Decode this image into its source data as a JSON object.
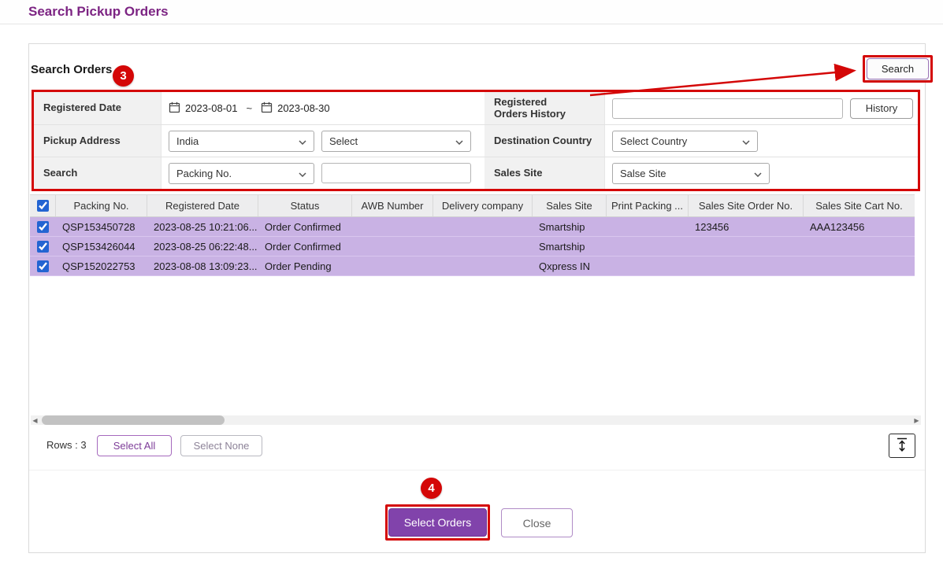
{
  "header": {
    "title": "Search Pickup Orders"
  },
  "search_panel": {
    "heading": "Search Orders",
    "step_badge_3": "3",
    "search_button": "Search",
    "rows": {
      "registered_date": {
        "label": "Registered Date",
        "from": "2023-08-01",
        "separator": "~",
        "to": "2023-08-30"
      },
      "registered_orders_history": {
        "label": "Registered Orders History",
        "input_value": "",
        "history_button": "History"
      },
      "pickup_address": {
        "label": "Pickup Address",
        "country_select": "India",
        "sub_select": "Select"
      },
      "destination_country": {
        "label": "Destination Country",
        "select": "Select Country"
      },
      "search": {
        "label": "Search",
        "type_select": "Packing No.",
        "input_value": ""
      },
      "sales_site": {
        "label": "Sales Site",
        "select": "Salse Site"
      }
    }
  },
  "orders_table": {
    "select_all_checked": true,
    "columns": [
      "Packing No.",
      "Registered Date",
      "Status",
      "AWB Number",
      "Delivery company",
      "Sales Site",
      "Print Packing ...",
      "Sales Site Order No.",
      "Sales Site Cart No."
    ],
    "rows": [
      {
        "selected": true,
        "packing_no": "QSP153450728",
        "registered_date": "2023-08-25 10:21:06...",
        "status": "Order Confirmed",
        "awb_number": "",
        "delivery_company": "",
        "sales_site": "Smartship",
        "print_packing": "",
        "sales_site_order_no": "123456",
        "sales_site_cart_no": "AAA123456"
      },
      {
        "selected": true,
        "packing_no": "QSP153426044",
        "registered_date": "2023-08-25 06:22:48...",
        "status": "Order Confirmed",
        "awb_number": "",
        "delivery_company": "",
        "sales_site": "Smartship",
        "print_packing": "",
        "sales_site_order_no": "",
        "sales_site_cart_no": ""
      },
      {
        "selected": true,
        "packing_no": "QSP152022753",
        "registered_date": "2023-08-08 13:09:23...",
        "status": "Order Pending",
        "awb_number": "",
        "delivery_company": "",
        "sales_site": "Qxpress IN",
        "print_packing": "",
        "sales_site_order_no": "",
        "sales_site_cart_no": ""
      }
    ]
  },
  "table_footer": {
    "rows_count_label": "Rows : 3",
    "select_all_button": "Select All",
    "select_none_button": "Select None"
  },
  "actions": {
    "step_badge_4": "4",
    "select_orders_button": "Select Orders",
    "close_button": "Close"
  },
  "colors": {
    "title_purple": "#7c2483",
    "row_highlight_purple": "#c9b2e4",
    "annotation_red": "#d40707",
    "primary_button_purple": "#8143ab",
    "checkbox_blue": "#2364d2"
  }
}
